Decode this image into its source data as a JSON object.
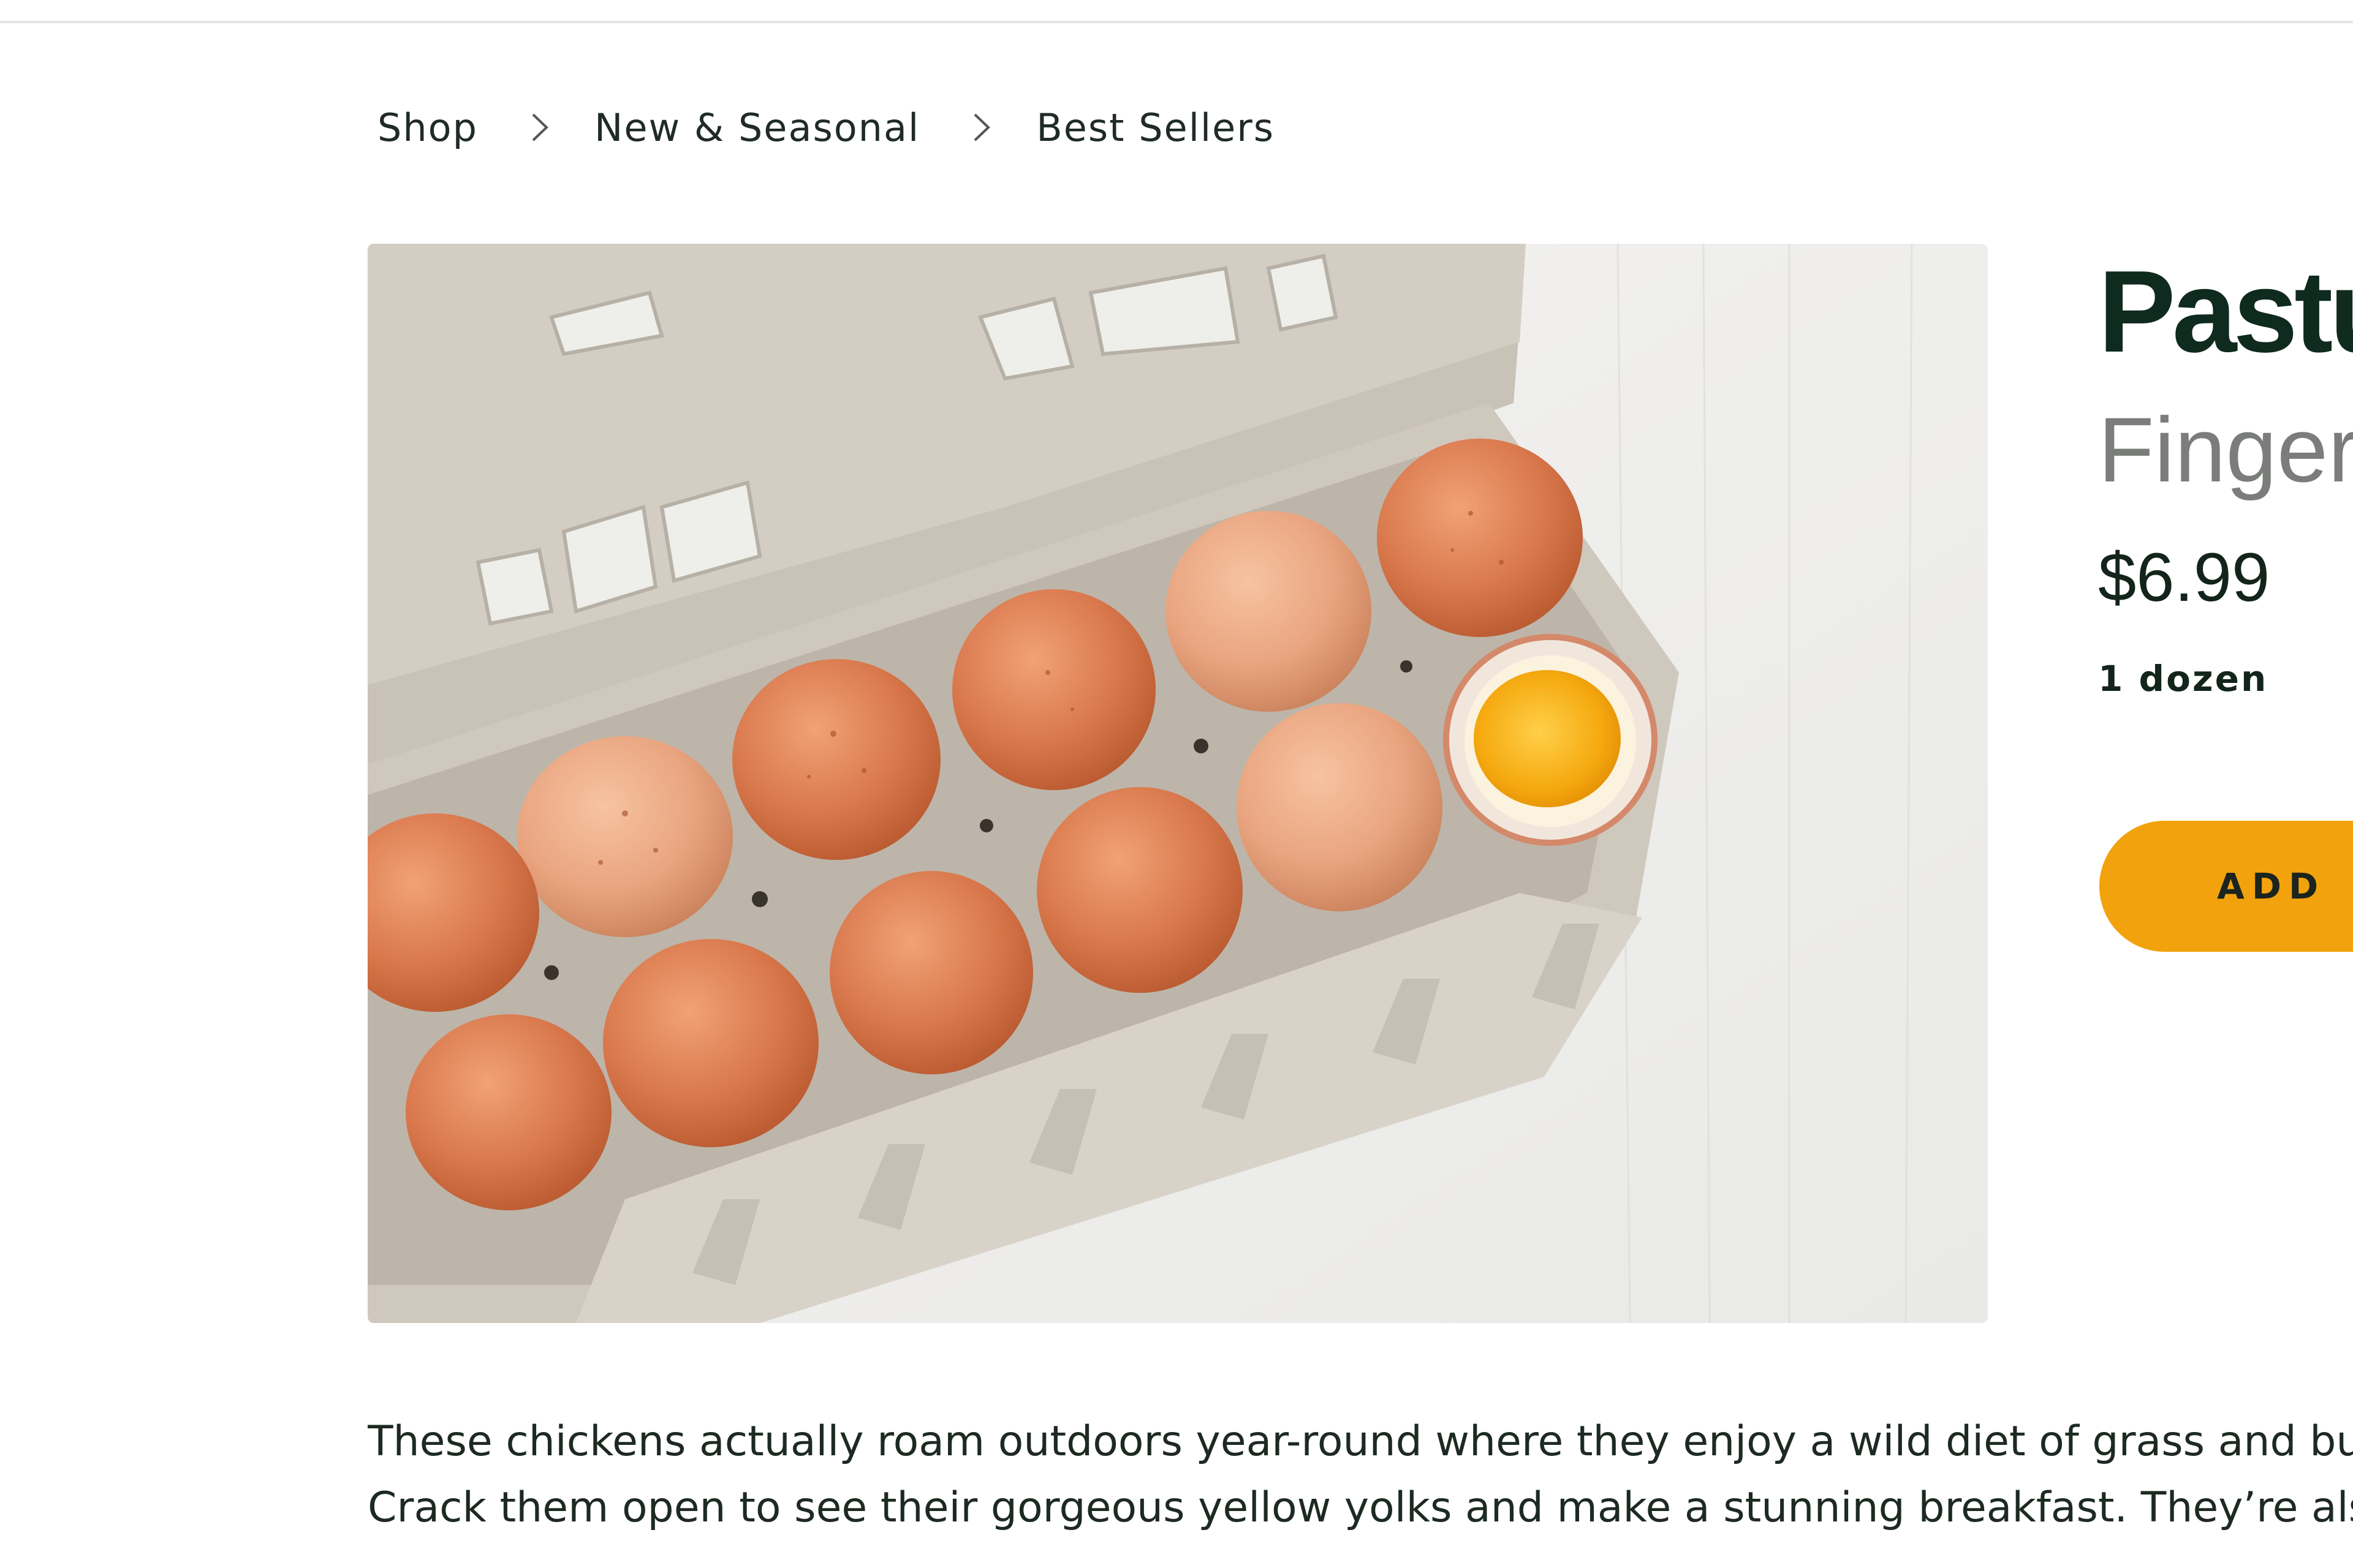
{
  "breadcrumb": {
    "items": [
      {
        "label": "Shop"
      },
      {
        "label": "New & Seasonal"
      },
      {
        "label": "Best Sellers"
      }
    ]
  },
  "product": {
    "title": "Pastu",
    "subtitle": "Finger",
    "price": "$6.99",
    "unit": "1 dozen",
    "add_label": "ADD",
    "image_alt": "Carton of brown eggs with one cracked egg showing yolk",
    "description": [
      "These chickens actually roam outdoors year-round where they enjoy a wild diet of grass and bu",
      "Crack them open to see their gorgeous yellow yolks and make a stunning breakfast. They’re als"
    ]
  },
  "colors": {
    "accent": "#f2a20c",
    "title": "#0f2a1e",
    "subtitle": "#7a7d7a",
    "text": "#1d2a22"
  },
  "icons": {
    "breadcrumb_separator": "chevron-right-icon"
  }
}
